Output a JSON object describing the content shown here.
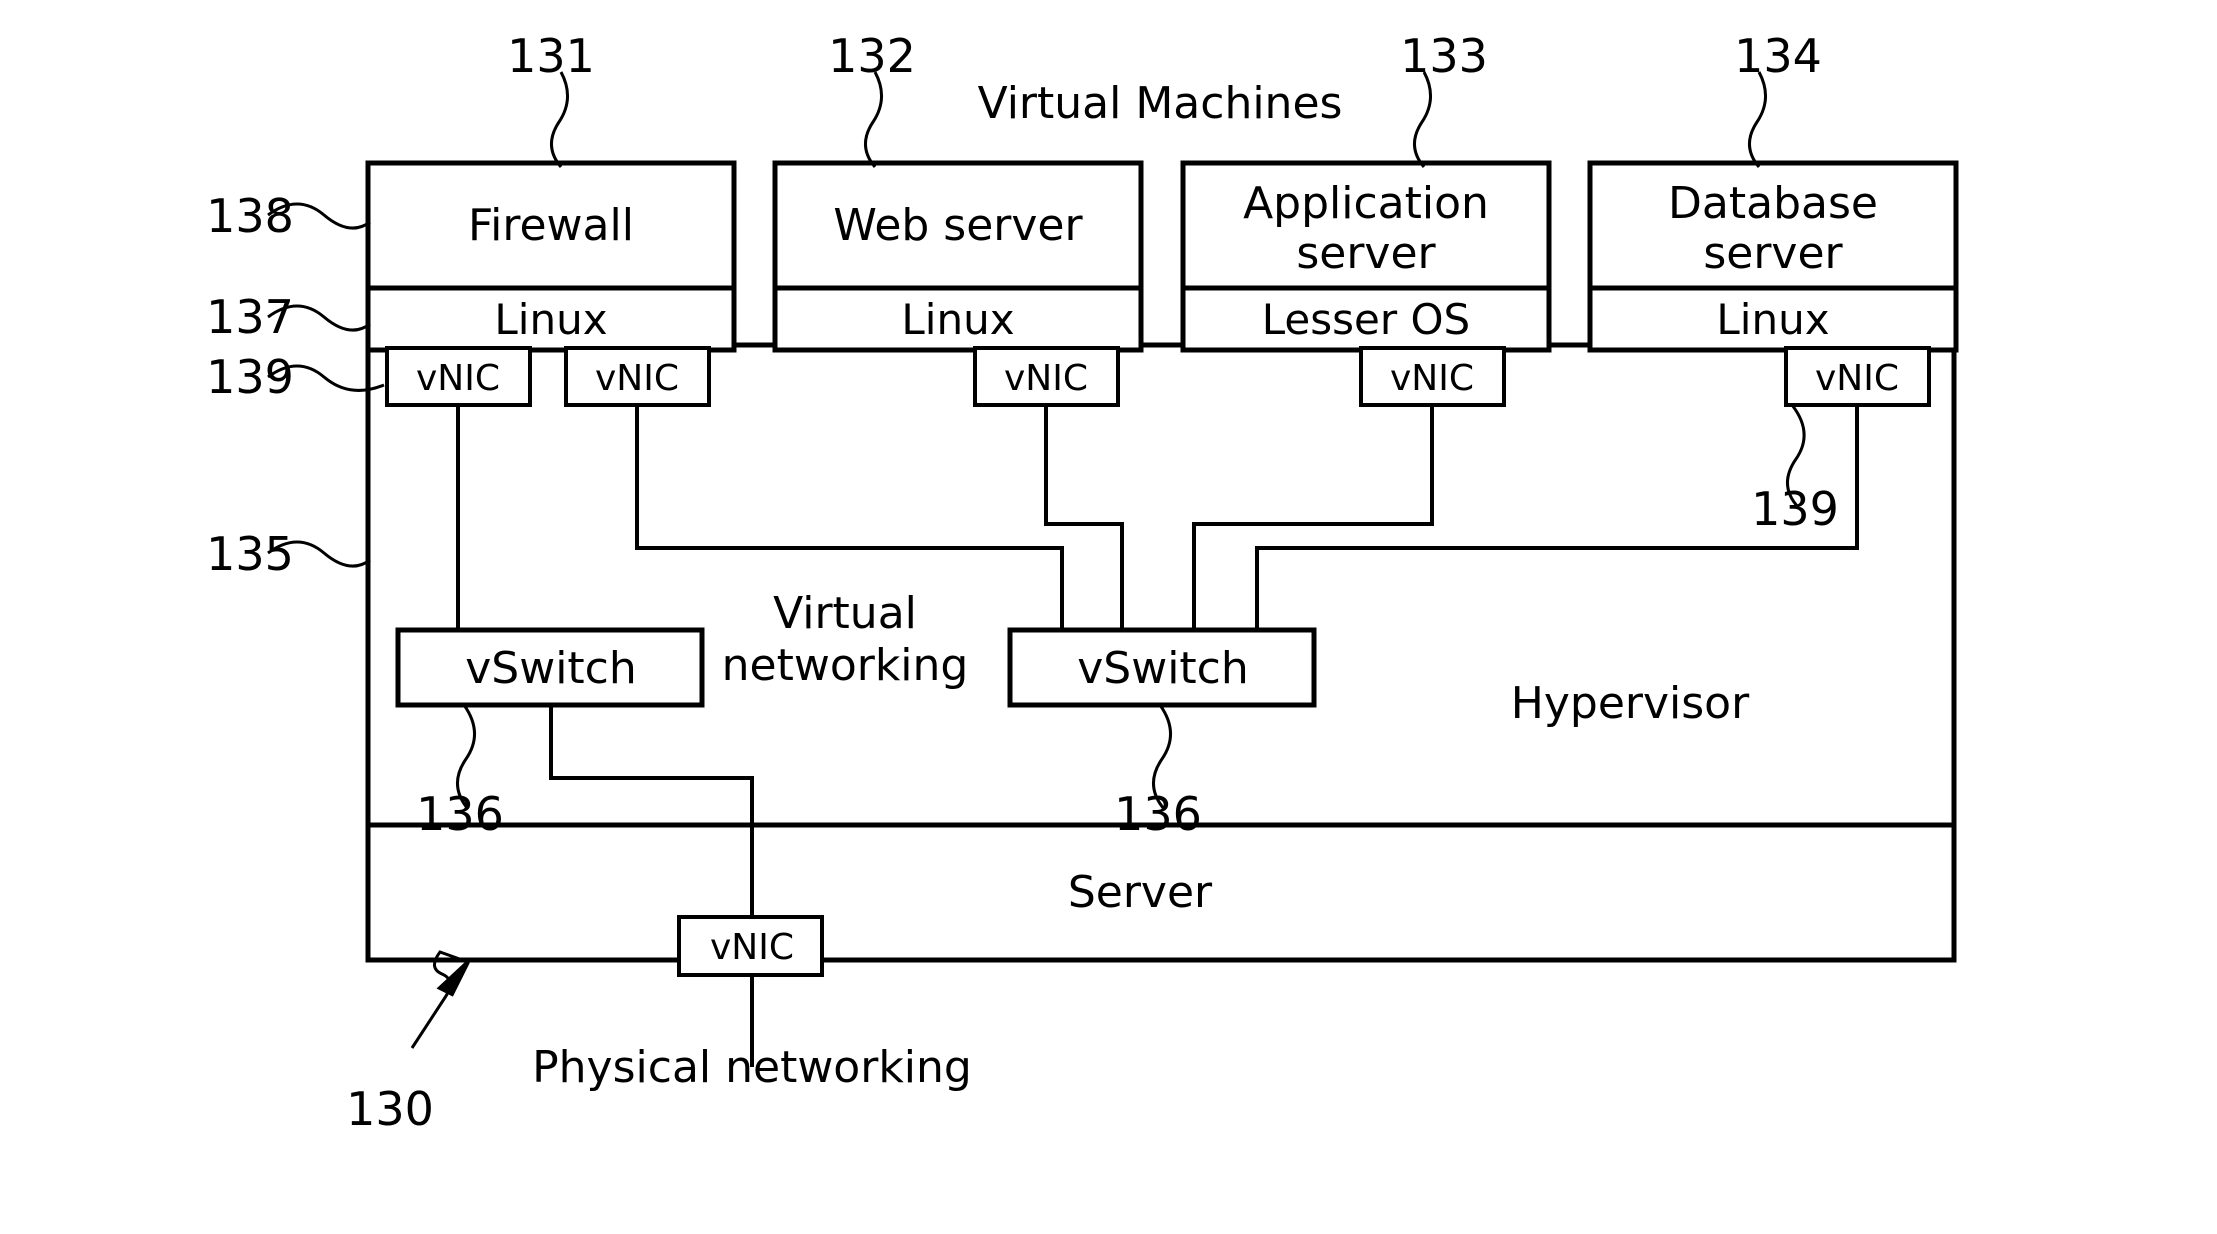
{
  "figure": {
    "title": "Virtual Machines",
    "system_ref": "130",
    "hypervisor_label": "Hypervisor",
    "hypervisor_ref": "135",
    "server_label": "Server",
    "virtual_networking_label_line1": "Virtual",
    "virtual_networking_label_line2": "networking",
    "physical_networking_label": "Physical networking",
    "app_layer_ref": "138",
    "os_layer_ref": "137",
    "vnic_ref": "139",
    "vnic_ref_right": "139",
    "vswitch_ref_left": "136",
    "vswitch_ref_right": "136"
  },
  "vms": [
    {
      "ref": "131",
      "app": "Firewall",
      "app_line2": "",
      "os": "Linux"
    },
    {
      "ref": "132",
      "app": "Web server",
      "app_line2": "",
      "os": "Linux"
    },
    {
      "ref": "133",
      "app": "Application",
      "app_line2": "server",
      "os": "Lesser OS"
    },
    {
      "ref": "134",
      "app": "Database",
      "app_line2": "server",
      "os": "Linux"
    }
  ],
  "vnics": [
    {
      "id": "vnic-1",
      "label": "vNIC"
    },
    {
      "id": "vnic-2",
      "label": "vNIC"
    },
    {
      "id": "vnic-3",
      "label": "vNIC"
    },
    {
      "id": "vnic-4",
      "label": "vNIC"
    },
    {
      "id": "vnic-5",
      "label": "vNIC"
    },
    {
      "id": "vnic-physical",
      "label": "vNIC"
    }
  ],
  "vswitches": [
    {
      "id": "vswitch-left",
      "label": "vSwitch"
    },
    {
      "id": "vswitch-right",
      "label": "vSwitch"
    }
  ],
  "colors": {
    "ink": "#000000",
    "paper": "#ffffff"
  }
}
